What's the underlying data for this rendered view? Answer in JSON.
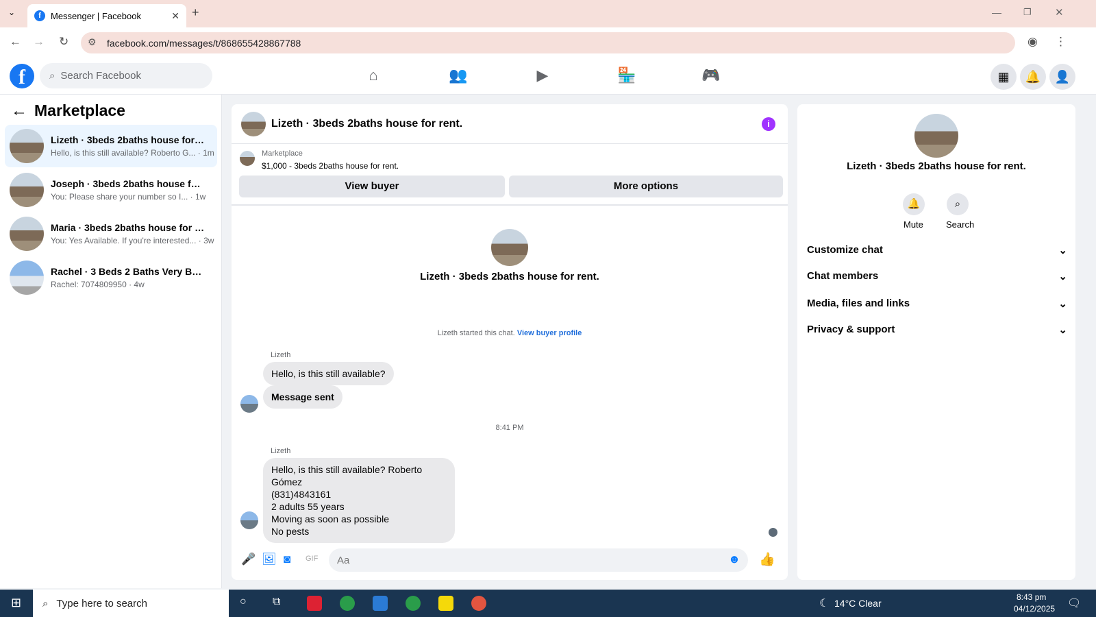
{
  "browser": {
    "tab_title": "Messenger | Facebook",
    "url": "facebook.com/messages/t/868655428867788"
  },
  "fb": {
    "search_placeholder": "Search Facebook"
  },
  "sidebar": {
    "title": "Marketplace",
    "conversations": [
      {
        "title": "Lizeth · 3beds 2baths house for rent.",
        "snippet": "Hello, is this still available? Roberto G... · 1m"
      },
      {
        "title": "Joseph · 3beds 2baths house for...",
        "snippet": "You: Please share your number so I... · 1w"
      },
      {
        "title": "Maria · 3beds 2baths house for rent.",
        "snippet": "You: Yes Available. If you're interested... · 3w"
      },
      {
        "title": "Rachel · 3 Beds 2 Baths Very Beaut...",
        "snippet": "Rachel: 7074809950 · 4w"
      }
    ]
  },
  "chat": {
    "title": "Lizeth · 3beds 2baths house for rent.",
    "marketplace_label": "Marketplace",
    "listing": "$1,000 - 3beds 2baths house for rent.",
    "view_buyer": "View buyer",
    "more_options": "More options",
    "center_name": "Lizeth · 3beds 2baths house for rent.",
    "started": "Lizeth started this chat.",
    "view_buyer_profile": "View buyer profile",
    "sender1": "Lizeth",
    "msg1": "Hello, is this still available?",
    "msg2": "Message sent",
    "time": "8:41 PM",
    "sender2": "Lizeth",
    "msg3_lines": [
      "Hello, is this still available? Roberto Gómez",
      "(831)4843161",
      "2 adults 55 years",
      "Moving as soon as possible",
      "No pests"
    ],
    "input_placeholder": "Aa"
  },
  "details": {
    "name": "Lizeth · 3beds 2baths house for rent.",
    "mute": "Mute",
    "search": "Search",
    "sections": [
      "Customize chat",
      "Chat members",
      "Media, files and links",
      "Privacy & support"
    ]
  },
  "taskbar": {
    "search": "Type here to search",
    "weather": "14°C  Clear",
    "time": "8:43 pm",
    "date": "04/12/2025"
  }
}
